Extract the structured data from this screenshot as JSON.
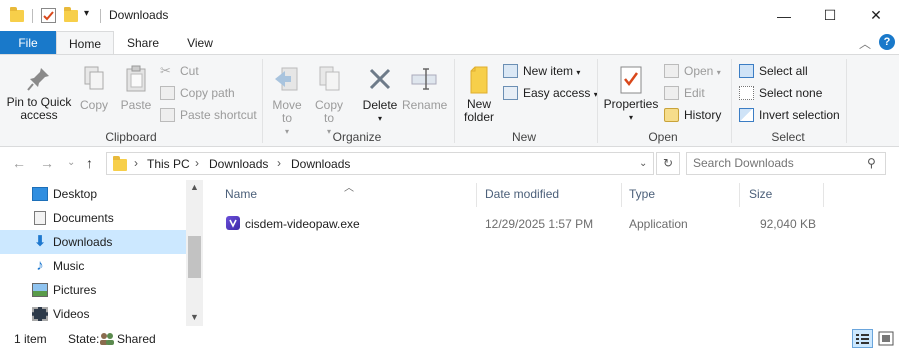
{
  "window": {
    "title": "Downloads",
    "minimize_glyph": "—",
    "maximize_glyph": "☐",
    "close_glyph": "✕"
  },
  "tabs": [
    {
      "label": "File"
    },
    {
      "label": "Home"
    },
    {
      "label": "Share"
    },
    {
      "label": "View"
    }
  ],
  "ribbon": {
    "clipboard": {
      "pin_label": "Pin to Quick access",
      "copy_label": "Copy",
      "paste_label": "Paste",
      "cut_label": "Cut",
      "copy_path_label": "Copy path",
      "paste_shortcut_label": "Paste shortcut",
      "group_label": "Clipboard"
    },
    "organize": {
      "move_to_label": "Move to",
      "copy_to_label": "Copy to",
      "delete_label": "Delete",
      "rename_label": "Rename",
      "group_label": "Organize"
    },
    "new": {
      "new_folder_label": "New folder",
      "new_item_label": "New item",
      "easy_access_label": "Easy access",
      "group_label": "New"
    },
    "open": {
      "properties_label": "Properties",
      "open_label": "Open",
      "edit_label": "Edit",
      "history_label": "History",
      "group_label": "Open"
    },
    "select": {
      "select_all_label": "Select all",
      "select_none_label": "Select none",
      "invert_selection_label": "Invert selection",
      "group_label": "Select"
    }
  },
  "address": {
    "crumbs": [
      "This PC",
      "Downloads",
      "Downloads"
    ]
  },
  "search": {
    "placeholder": "Search Downloads"
  },
  "nav_pane": {
    "items": [
      {
        "label": "Desktop",
        "icon": "desktop-icon"
      },
      {
        "label": "Documents",
        "icon": "documents-icon"
      },
      {
        "label": "Downloads",
        "icon": "downloads-icon",
        "selected": true
      },
      {
        "label": "Music",
        "icon": "music-icon"
      },
      {
        "label": "Pictures",
        "icon": "pictures-icon"
      },
      {
        "label": "Videos",
        "icon": "videos-icon"
      }
    ]
  },
  "file_list": {
    "columns": [
      "Name",
      "Date modified",
      "Type",
      "Size"
    ],
    "rows": [
      {
        "name": "cisdem-videopaw.exe",
        "date_modified": "12/29/2025 1:57 PM",
        "type": "Application",
        "size": "92,040 KB"
      }
    ]
  },
  "status": {
    "item_count": "1 item",
    "state_label": "State:",
    "state_value": "Shared"
  },
  "colors": {
    "file_tab": "#1979ca",
    "selected_nav": "#cce8ff",
    "folder_yellow": "#f7cf4a",
    "column_header_text": "#4c607a"
  }
}
